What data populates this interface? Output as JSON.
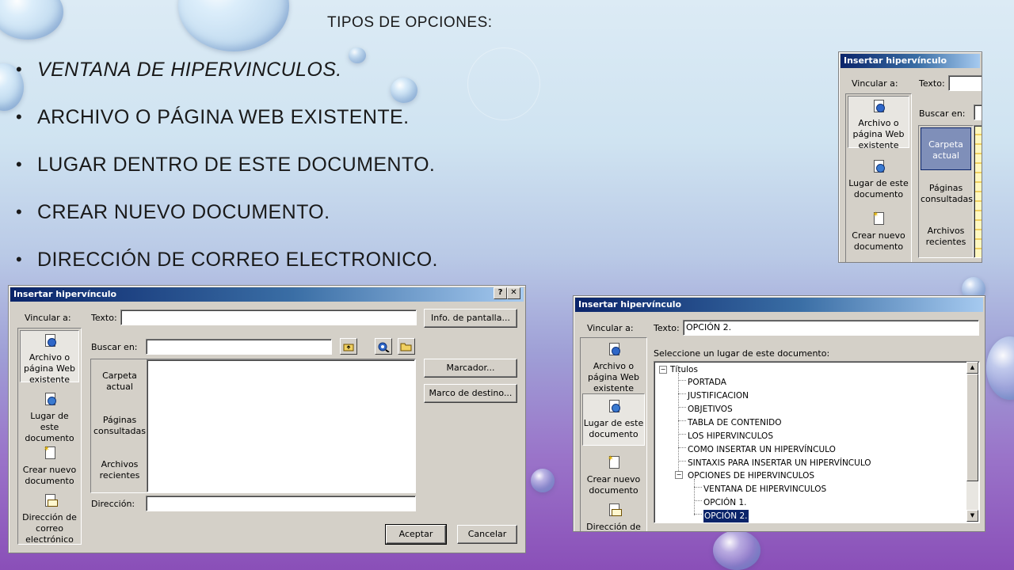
{
  "slide": {
    "title": "TIPOS DE OPCIONES:",
    "bullets": [
      {
        "text": "VENTANA DE HIPERVINCULOS.",
        "italic": true
      },
      {
        "text": "ARCHIVO O PÁGINA WEB EXISTENTE.",
        "italic": false
      },
      {
        "text": "LUGAR DENTRO DE ESTE DOCUMENTO.",
        "italic": false
      },
      {
        "text": "CREAR NUEVO DOCUMENTO.",
        "italic": false
      },
      {
        "text": "DIRECCIÓN DE CORREO ELECTRONICO.",
        "italic": false
      }
    ],
    "bullet_char": "•"
  },
  "dialog_main": {
    "title": "Insertar hipervínculo",
    "help_btn": "?",
    "close_btn": "✕",
    "vincular_label": "Vincular a:",
    "nav": [
      {
        "line1": "Archivo o",
        "line2": "página Web",
        "line3": "existente",
        "icon": "web-page-icon"
      },
      {
        "line1": "Lugar de este",
        "line2": "documento",
        "icon": "bookmark-page-icon"
      },
      {
        "line1": "Crear nuevo",
        "line2": "documento",
        "icon": "new-document-icon"
      },
      {
        "line1": "Dirección de",
        "line2": "correo",
        "line3": "electrónico",
        "icon": "email-icon"
      }
    ],
    "texto_label": "Texto:",
    "texto_value": "",
    "screen_tip_btn": "Info. de pantalla...",
    "buscar_label": "Buscar en:",
    "buscar_value": "",
    "marcador_btn": "Marcador...",
    "marco_btn": "Marco de destino...",
    "sub_nav": [
      {
        "line1": "Carpeta",
        "line2": "actual"
      },
      {
        "line1": "Páginas",
        "line2": "consultadas"
      },
      {
        "line1": "Archivos",
        "line2": "recientes"
      }
    ],
    "direccion_label": "Dirección:",
    "direccion_value": "",
    "ok_btn": "Aceptar",
    "cancel_btn": "Cancelar"
  },
  "dialog_right": {
    "title": "Insertar hipervínculo",
    "vincular_label": "Vincular a:",
    "texto_label": "Texto:",
    "texto_value": "OPCIÓN 2.",
    "select_label": "Seleccione un lugar de este documento:",
    "nav": [
      {
        "line1": "Archivo o",
        "line2": "página Web",
        "line3": "existente"
      },
      {
        "line1": "Lugar de este",
        "line2": "documento"
      },
      {
        "line1": "Crear nuevo",
        "line2": "documento"
      },
      {
        "line1": "Dirección de",
        "line2": ""
      }
    ],
    "tree_root": "Títulos",
    "tree_items": [
      "PORTADA",
      "JUSTIFICACION",
      "OBJETIVOS",
      "TABLA DE CONTENIDO",
      "LOS HIPERVINCULOS",
      "COMO INSERTAR UN HIPERVÍNCULO",
      "SINTAXIS PARA INSERTAR UN HIPERVÍNCULO",
      "OPCIONES DE HIPERVINCULOS"
    ],
    "tree_sub_items": [
      "VENTANA DE HIPERVINCULOS",
      "OPCIÓN 1.",
      "OPCIÓN 2."
    ],
    "plus_minus": "−"
  },
  "dialog_small": {
    "title": "Insertar hipervínculo",
    "vincular_label": "Vincular a:",
    "texto_label": "Texto:",
    "buscar_label": "Buscar en:",
    "nav": [
      {
        "line1": "Archivo o",
        "line2": "página Web",
        "line3": "existente"
      },
      {
        "line1": "Lugar de este",
        "line2": "documento"
      },
      {
        "line1": "Crear nuevo",
        "line2": "documento"
      }
    ],
    "sub_nav": [
      {
        "line1": "Carpeta",
        "line2": "actual"
      },
      {
        "line1": "Páginas",
        "line2": "consultadas"
      },
      {
        "line1": "Archivos",
        "line2": "recientes"
      }
    ]
  }
}
